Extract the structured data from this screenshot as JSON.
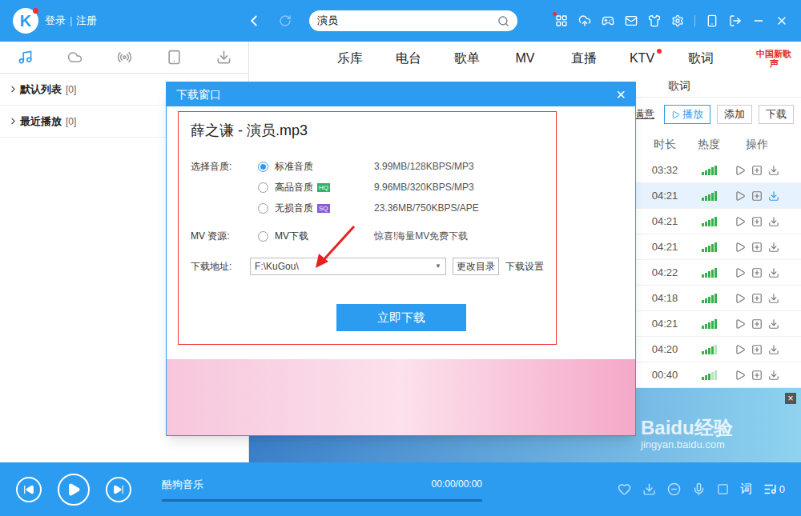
{
  "app": {
    "logo": "K",
    "login": "登录",
    "separator": "|",
    "register": "注册"
  },
  "search": {
    "value": "演员"
  },
  "sidebar": {
    "tabs": [
      {
        "selected": true
      },
      {
        "selected": false
      },
      {
        "selected": false
      },
      {
        "selected": false
      },
      {
        "selected": false
      }
    ],
    "playlists": [
      {
        "name": "默认列表",
        "count": "[0]"
      },
      {
        "name": "最近播放",
        "count": "[0]"
      }
    ]
  },
  "nav": [
    {
      "label": "乐库",
      "badge": false
    },
    {
      "label": "电台",
      "badge": false
    },
    {
      "label": "歌单",
      "badge": false
    },
    {
      "label": "MV",
      "badge": false
    },
    {
      "label": "直播",
      "badge": false
    },
    {
      "label": "KTV",
      "badge": true
    },
    {
      "label": "歌词",
      "badge": false
    }
  ],
  "promo": "中国新歌声",
  "subtab": "歌词",
  "toolbar": {
    "link": "满意",
    "buttons": [
      {
        "label": "播放",
        "primary": true
      },
      {
        "label": "添加",
        "primary": false
      },
      {
        "label": "下载",
        "primary": false
      }
    ]
  },
  "table": {
    "columns": [
      "时长",
      "热度",
      "操作"
    ],
    "rows": [
      {
        "duration": "03:32",
        "heat": 1,
        "selected": false
      },
      {
        "duration": "04:21",
        "heat": 1,
        "selected": true
      },
      {
        "duration": "04:21",
        "heat": 1,
        "selected": false
      },
      {
        "duration": "04:21",
        "heat": 1,
        "selected": false
      },
      {
        "duration": "04:22",
        "heat": 1,
        "selected": false
      },
      {
        "duration": "04:18",
        "heat": 1,
        "selected": false
      },
      {
        "duration": "04:21",
        "heat": 1,
        "selected": false
      },
      {
        "duration": "04:20",
        "heat": 0.8,
        "selected": false
      },
      {
        "duration": "00:40",
        "heat": 0.6,
        "selected": false
      }
    ]
  },
  "ad_close": "×",
  "dialog": {
    "title": "下载窗口",
    "close": "×",
    "filename": "薛之谦 - 演员.mp3",
    "quality_label": "选择音质:",
    "qualities": [
      {
        "label": "标准音质",
        "badge": "",
        "color": "#ffffff",
        "info": "3.99MB/128KBPS/MP3",
        "selected": true
      },
      {
        "label": "高品音质",
        "badge": "HQ",
        "color": "#2fb36b",
        "info": "9.96MB/320KBPS/MP3",
        "selected": false
      },
      {
        "label": "无损音质",
        "badge": "SQ",
        "color": "#8a5cd6",
        "info": "23.36MB/750KBPS/APE",
        "selected": false
      }
    ],
    "mv_label": "MV 资源:",
    "mv": {
      "label": "MV下载",
      "selected": false,
      "info": "惊喜!海量MV免费下载"
    },
    "path_label": "下载地址:",
    "path": "F:\\KuGou\\",
    "change_button": "更改目录",
    "settings": "下载设置",
    "download_button": "立即下载"
  },
  "player": {
    "title": "酷狗音乐",
    "time": "00:00/00:00",
    "progress": 0,
    "lyric": "词",
    "count": "0"
  },
  "watermark": {
    "brand": "Baidu经验",
    "url": "jingyan.baidu.com"
  }
}
